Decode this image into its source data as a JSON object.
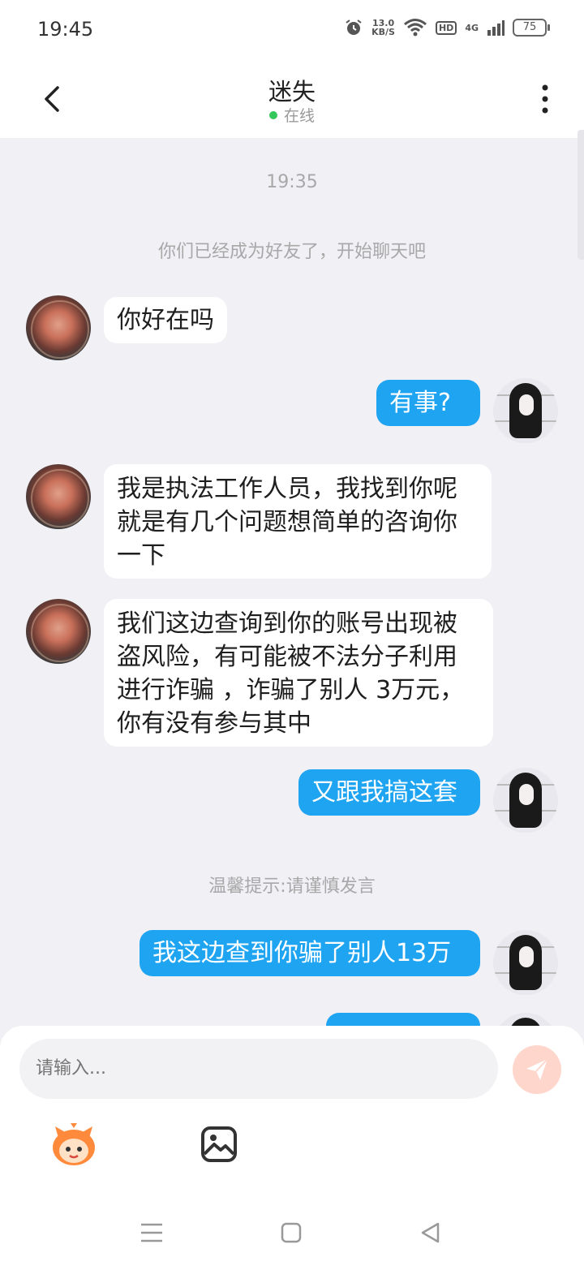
{
  "status_bar": {
    "time": "19:45",
    "net_speed_value": "13.0",
    "net_speed_unit": "KB/S",
    "hd": "HD",
    "signal": "4G",
    "battery": "75"
  },
  "header": {
    "title": "迷失",
    "status": "在线",
    "status_color": "#34c759"
  },
  "chat": {
    "timestamp": "19:35",
    "system_friend": "你们已经成为好友了，开始聊天吧",
    "system_tip": "温馨提示:请谨慎发言",
    "messages": [
      {
        "side": "in",
        "text": "你好在吗"
      },
      {
        "side": "out",
        "text": "有事?"
      },
      {
        "side": "in",
        "text": "我是执法工作人员，我找到你呢就是有几个问题想简单的咨询你一下"
      },
      {
        "side": "in",
        "text": "我们这边查询到你的账号出现被盗风险，有可能被不法分子利用进行诈骗 ，诈骗了别人 3万元，你有没有参与其中"
      },
      {
        "side": "out",
        "text": "又跟我搞这套"
      },
      {
        "side": "out",
        "text": "我这边查到你骗了别人13万"
      }
    ]
  },
  "input": {
    "placeholder": "请输入..."
  },
  "colors": {
    "outgoing_bubble": "#1fa4f2",
    "incoming_bubble": "#ffffff",
    "send_button": "#ffd6cc"
  },
  "icons": {
    "back": "chevron-left-icon",
    "more": "more-vertical-icon",
    "send": "send-icon",
    "emoji": "emoji-icon",
    "image": "image-icon"
  }
}
